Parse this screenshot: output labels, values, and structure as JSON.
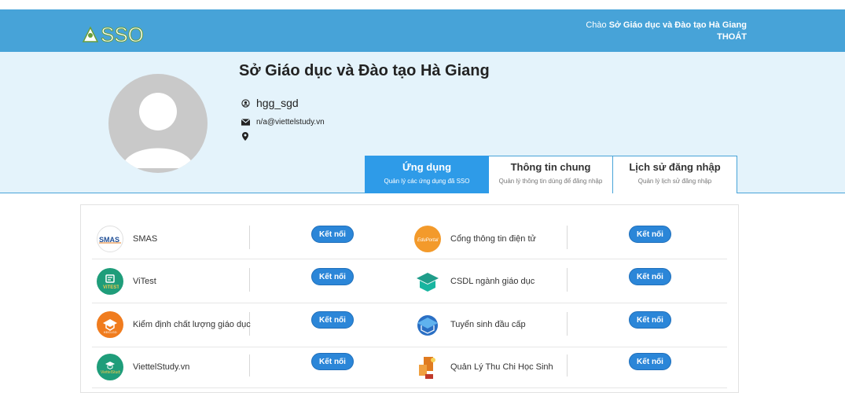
{
  "header": {
    "logo_text": "SSO",
    "greeting_prefix": "Chào",
    "user_org": "Sở Giáo dục và Đào tạo Hà Giang",
    "logout_label": "THOÁT",
    "bg_color": "#47a3d8"
  },
  "profile": {
    "name": "Sở Giáo dục và Đào tạo Hà Giang",
    "username": "hgg_sgd",
    "email": "n/a@viettelstudy.vn",
    "location": ""
  },
  "tabs": [
    {
      "title": "Ứng dụng",
      "subtitle": "Quản lý các ứng dụng đã SSO",
      "active": true
    },
    {
      "title": "Thông tin chung",
      "subtitle": "Quản lý thông tin dùng để đăng nhập",
      "active": false
    },
    {
      "title": "Lịch sử đăng nhập",
      "subtitle": "Quản lý lịch sử đăng nhập",
      "active": false
    }
  ],
  "apps": [
    {
      "name": "SMAS",
      "icon": "smas-icon",
      "button": "Kết nối"
    },
    {
      "name": "Cổng thông tin điện tử",
      "icon": "eduportal-icon",
      "button": "Kết nối"
    },
    {
      "name": "ViTest",
      "icon": "vitest-icon",
      "button": "Kết nối"
    },
    {
      "name": "CSDL ngành giáo dục",
      "icon": "csdl-icon",
      "button": "Kết nối"
    },
    {
      "name": "Kiểm định chất lượng giáo dục",
      "icon": "kdclgd-icon",
      "button": "Kết nối"
    },
    {
      "name": "Tuyển sinh đầu cấp",
      "icon": "tuyensinh-icon",
      "button": "Kết nối"
    },
    {
      "name": "ViettelStudy.vn",
      "icon": "viettelstudy-icon",
      "button": "Kết nối"
    },
    {
      "name": "Quản Lý Thu Chi Học Sinh",
      "icon": "thuchi-icon",
      "button": "Kết nối"
    }
  ]
}
